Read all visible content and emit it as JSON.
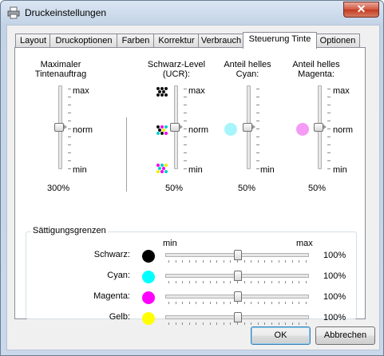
{
  "window": {
    "title": "Druckeinstellungen",
    "close_glyph": "✕"
  },
  "tabs": [
    "Layout",
    "Druckoptionen",
    "Farben",
    "Korrektur",
    "Verbrauch",
    "Steuerung Tinte",
    "Optionen"
  ],
  "active_tab": "Steuerung Tinte",
  "sliders": [
    {
      "label": "Maximaler\nTintenauftrag",
      "max": "max",
      "norm": "norm",
      "min": "min",
      "value": "300%",
      "position": 0.5
    },
    {
      "label": "Schwarz-Level\n(UCR):",
      "max": "max",
      "norm": "norm",
      "min": "min",
      "value": "50%",
      "position": 0.5,
      "icons": [
        "black-dots-icon",
        "mixed-color-dots-icon",
        "color-dots-icon"
      ]
    },
    {
      "label": "Anteil helles\nCyan:",
      "max": "max",
      "norm": "norm",
      "min": "min",
      "value": "50%",
      "position": 0.5,
      "swatch": "#a6f5fb"
    },
    {
      "label": "Anteil helles\nMagenta:",
      "max": "max",
      "norm": "norm",
      "min": "min",
      "value": "50%",
      "position": 0.5,
      "swatch": "#f59af5"
    }
  ],
  "saturation": {
    "title": "Sättigungsgrenzen",
    "min_label": "min",
    "max_label": "max",
    "rows": [
      {
        "label": "Schwarz:",
        "color": "#000000",
        "value": "100%",
        "position": 0.5
      },
      {
        "label": "Cyan:",
        "color": "#00ffff",
        "value": "100%",
        "position": 0.5
      },
      {
        "label": "Magenta:",
        "color": "#ff00ff",
        "value": "100%",
        "position": 0.5
      },
      {
        "label": "Gelb:",
        "color": "#ffff00",
        "value": "100%",
        "position": 0.5
      }
    ]
  },
  "buttons": {
    "ok": "OK",
    "cancel": "Abbrechen"
  }
}
